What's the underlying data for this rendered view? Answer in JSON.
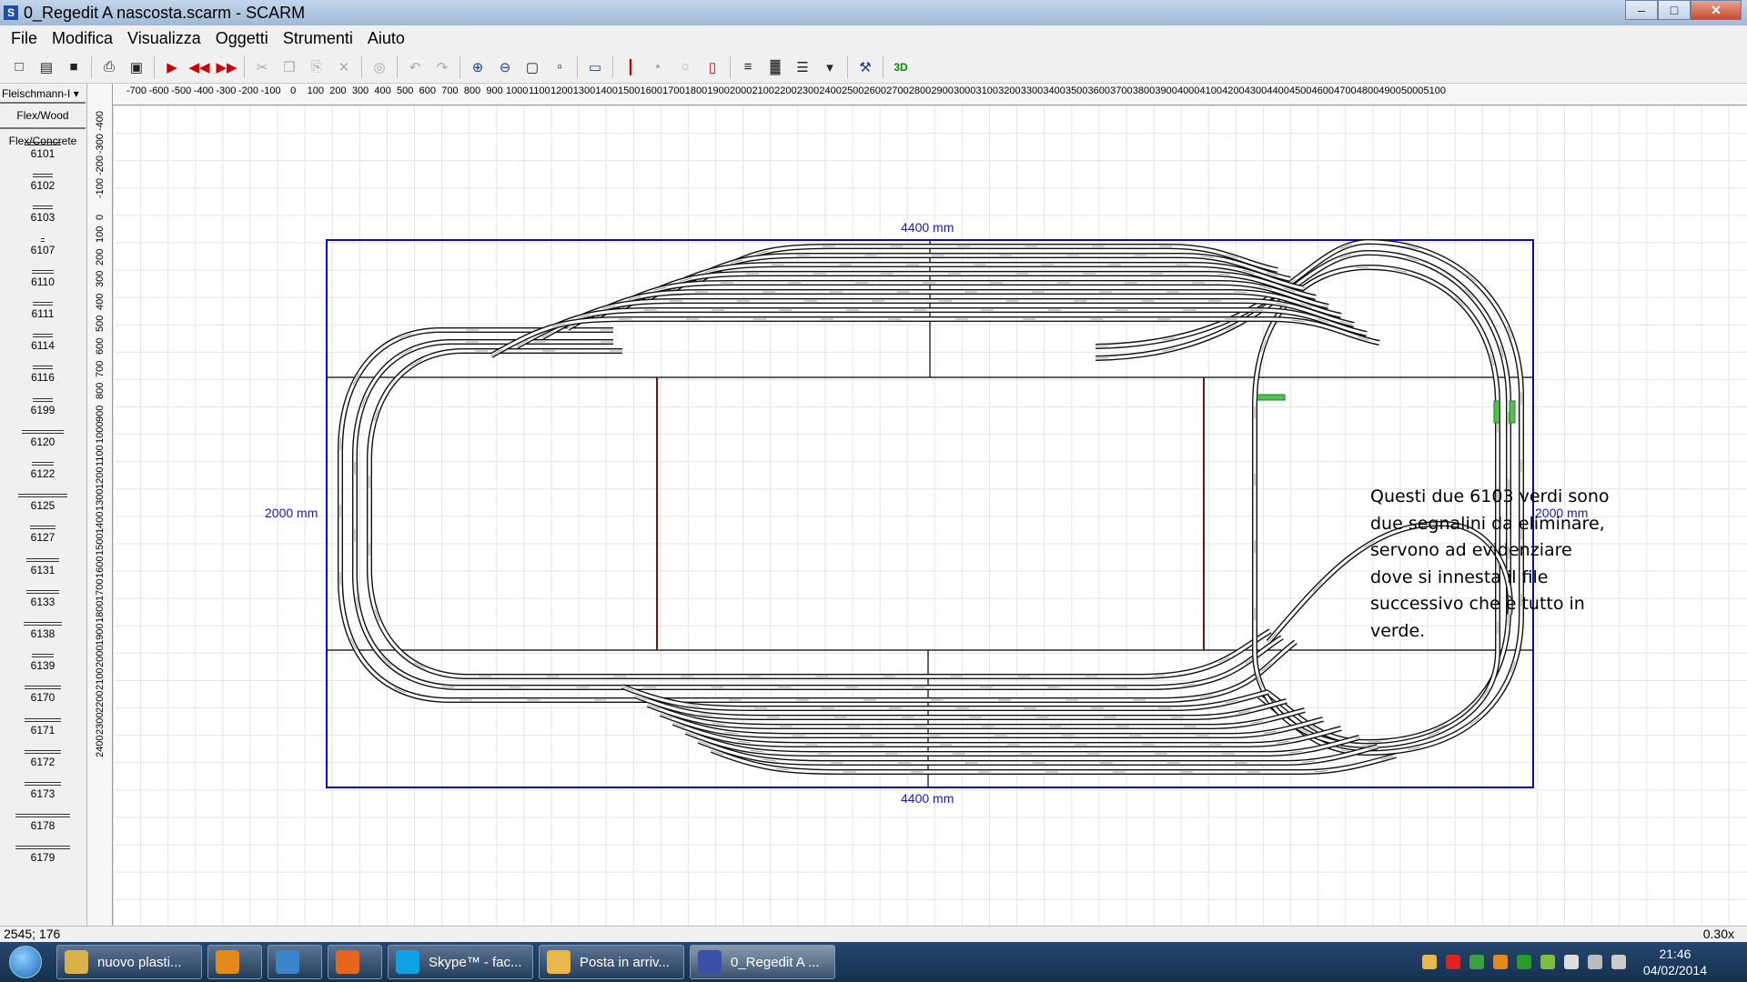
{
  "window": {
    "title": "0_Regedit A nascosta.scarm - SCARM",
    "icon": "S",
    "minimize": "–",
    "maximize": "□",
    "close": "✕"
  },
  "menu": [
    "File",
    "Modifica",
    "Visualizza",
    "Oggetti",
    "Strumenti",
    "Aiuto"
  ],
  "toolbar": [
    {
      "name": "new-file-icon",
      "glyph": "□",
      "style": ""
    },
    {
      "name": "open-folder-icon",
      "glyph": "▤",
      "style": ""
    },
    {
      "name": "save-icon",
      "glyph": "■",
      "style": ""
    },
    {
      "sep": true
    },
    {
      "name": "print-icon",
      "glyph": "⎙",
      "style": ""
    },
    {
      "name": "print-preview-icon",
      "glyph": "▣",
      "style": ""
    },
    {
      "sep": true
    },
    {
      "name": "play-icon",
      "glyph": "▶",
      "style": "red"
    },
    {
      "name": "rewind-icon",
      "glyph": "◀◀",
      "style": "red"
    },
    {
      "name": "fast-forward-icon",
      "glyph": "▶▶",
      "style": "red"
    },
    {
      "sep": true
    },
    {
      "name": "cut-icon",
      "glyph": "✂",
      "style": "dim"
    },
    {
      "name": "copy-icon",
      "glyph": "❐",
      "style": "dim"
    },
    {
      "name": "paste-icon",
      "glyph": "⎘",
      "style": "dim"
    },
    {
      "name": "delete-icon",
      "glyph": "✕",
      "style": "dim"
    },
    {
      "sep": true
    },
    {
      "name": "find-icon",
      "glyph": "◎",
      "style": "dim"
    },
    {
      "sep": true
    },
    {
      "name": "undo-icon",
      "glyph": "↶",
      "style": "dim"
    },
    {
      "name": "redo-icon",
      "glyph": "↷",
      "style": "dim"
    },
    {
      "sep": true
    },
    {
      "name": "zoom-in-icon",
      "glyph": "⊕",
      "style": "blue"
    },
    {
      "name": "zoom-out-icon",
      "glyph": "⊖",
      "style": "blue"
    },
    {
      "name": "zoom-fit-icon",
      "glyph": "▢",
      "style": ""
    },
    {
      "name": "zoom-window-icon",
      "glyph": "▫",
      "style": ""
    },
    {
      "sep": true
    },
    {
      "name": "background-image-icon",
      "glyph": "▭",
      "style": "blue"
    },
    {
      "sep": true
    },
    {
      "name": "flex-track-icon",
      "glyph": "┃",
      "style": "red"
    },
    {
      "name": "lock-icon",
      "glyph": "•",
      "style": "dim"
    },
    {
      "name": "fix-icon",
      "glyph": "○",
      "style": "dim"
    },
    {
      "name": "break-icon",
      "glyph": "▯",
      "style": "red"
    },
    {
      "sep": true
    },
    {
      "name": "bridge-icon",
      "glyph": "≡",
      "style": ""
    },
    {
      "name": "tunnel-icon",
      "glyph": "▓",
      "style": ""
    },
    {
      "name": "layers-icon",
      "glyph": "☰",
      "style": ""
    },
    {
      "name": "layers-dropdown-icon",
      "glyph": "▾",
      "style": ""
    },
    {
      "sep": true
    },
    {
      "name": "measure-icon",
      "glyph": "⚒",
      "style": "blue"
    },
    {
      "sep": true
    },
    {
      "name": "3d-view-icon",
      "glyph": "3D",
      "style": "green"
    }
  ],
  "palette": {
    "library": "Fleischmann-I ▾",
    "categories": [
      "Flex/Wood",
      "Flex/Concrete"
    ],
    "items": [
      "6101",
      "6102",
      "6103",
      "6107",
      "6110",
      "6111",
      "6114",
      "6116",
      "6199",
      "6120",
      "6122",
      "6125",
      "6127",
      "6131",
      "6133",
      "6138",
      "6139",
      "6170",
      "6171",
      "6172",
      "6173",
      "6178",
      "6179"
    ]
  },
  "ruler": {
    "units": "mm",
    "h_ticks": [
      "-700",
      "-600",
      "-500",
      "-400",
      "-300",
      "-200",
      "-100",
      "0",
      "100",
      "200",
      "300",
      "400",
      "500",
      "600",
      "700",
      "800",
      "900",
      "1000",
      "1100",
      "1200",
      "1300",
      "1400",
      "1500",
      "1600",
      "1700",
      "1800",
      "1900",
      "2000",
      "2100",
      "2200",
      "2300",
      "2400",
      "2500",
      "2600",
      "2700",
      "2800",
      "2900",
      "3000",
      "3100",
      "3200",
      "3300",
      "3400",
      "3500",
      "3600",
      "3700",
      "3800",
      "3900",
      "4000",
      "4100",
      "4200",
      "4300",
      "4400",
      "4500",
      "4600",
      "4700",
      "4800",
      "4900",
      "5000",
      "5100"
    ],
    "v_ticks": [
      "-400",
      "-300",
      "-200",
      "-100",
      "0",
      "100",
      "200",
      "300",
      "400",
      "500",
      "600",
      "700",
      "800",
      "900",
      "1000",
      "1100",
      "1200",
      "1300",
      "1400",
      "1500",
      "1600",
      "1700",
      "1800",
      "1900",
      "2000",
      "2100",
      "2200",
      "2300",
      "2400"
    ]
  },
  "layout": {
    "dim_top": "4400 mm",
    "dim_bottom": "4400 mm",
    "dim_left": "2000 mm",
    "dim_right": "2000 mm",
    "board_color": "#0b0bb0",
    "divider_color": "#7a1010",
    "highlight_color": "#4fc24f",
    "note": "Questi due 6103 verdi sono due segnalini da eliminare, servono ad evidenziare dove si innesta il file successivo che è tutto in verde."
  },
  "status": {
    "coords": "2545; 176",
    "zoom": "0.30x"
  },
  "taskbar": {
    "items": [
      {
        "name": "taskbar-folder",
        "label": "nuovo plasti...",
        "color": "#d8b14a",
        "active": false
      },
      {
        "name": "taskbar-media-player",
        "label": "",
        "color": "#e48a1c",
        "active": false
      },
      {
        "name": "taskbar-network",
        "label": "",
        "color": "#3b84c9",
        "active": false
      },
      {
        "name": "taskbar-firefox",
        "label": "",
        "color": "#e5661c",
        "active": false
      },
      {
        "name": "taskbar-skype",
        "label": "Skype™ - fac...",
        "color": "#10a0e4",
        "active": false
      },
      {
        "name": "taskbar-mail",
        "label": "Posta in arriv...",
        "color": "#e8b84a",
        "active": false
      },
      {
        "name": "taskbar-scarm",
        "label": "0_Regedit A ...",
        "color": "#3a4fa8",
        "active": true
      }
    ],
    "clock_time": "21:46",
    "clock_date": "04/02/2014"
  }
}
